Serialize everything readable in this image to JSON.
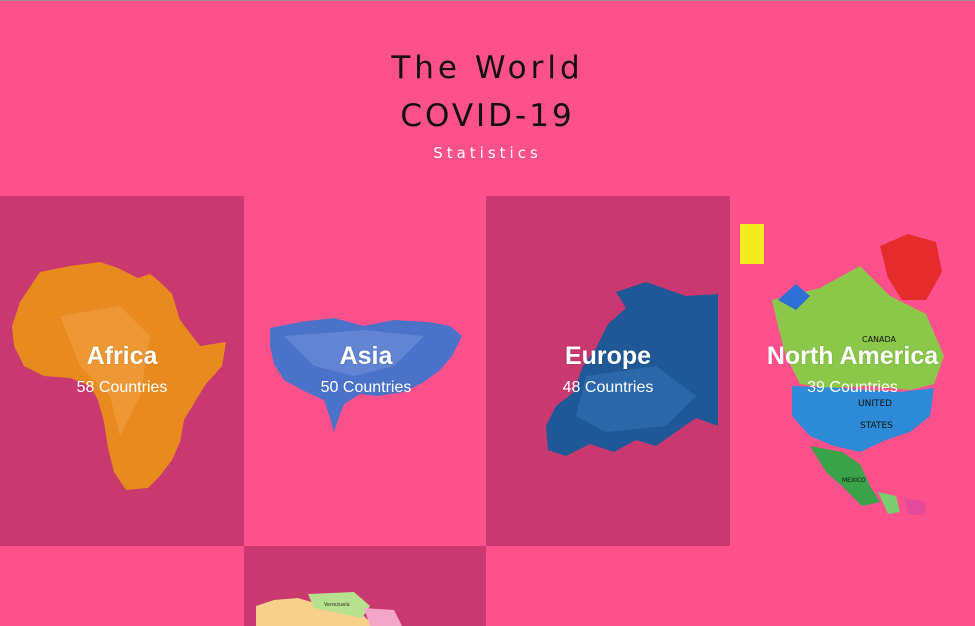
{
  "header": {
    "title_line1": "The World",
    "title_line2": "COVID-19",
    "subtitle": "Statistics"
  },
  "continents": [
    {
      "name": "Africa",
      "count": "58 Countries",
      "map_icon": "africa-map-icon"
    },
    {
      "name": "Asia",
      "count": "50 Countries",
      "map_icon": "asia-map-icon"
    },
    {
      "name": "Europe",
      "count": "48 Countries",
      "map_icon": "europe-map-icon"
    },
    {
      "name": "North America",
      "count": "39 Countries",
      "map_icon": "north-america-map-icon"
    }
  ],
  "map_labels": {
    "canada": "CANADA",
    "united": "UNITED",
    "states": "STATES",
    "mexico": "MEXICO",
    "south_map_label": "Venezuela"
  },
  "colors": {
    "page_bg": "#fe518b",
    "tile_dark": "#c9386f",
    "africa": "#e88b1f",
    "asia": "#4a72c9",
    "europe": "#1f5896",
    "text_dark": "#111111",
    "text_light": "#ffffff"
  }
}
